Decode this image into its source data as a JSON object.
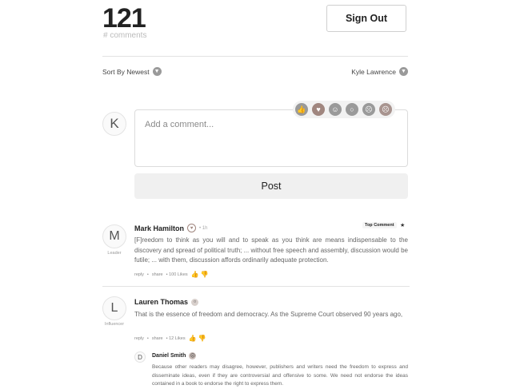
{
  "header": {
    "count": "121",
    "count_label": "# comments",
    "signout_label": "Sign Out"
  },
  "sortbar": {
    "sort_label": "Sort By Newest",
    "user_name": "Kyle Lawrence"
  },
  "composer": {
    "avatar_letter": "K",
    "placeholder": "Add a comment...",
    "post_label": "Post",
    "reactions": [
      "like-icon",
      "heart-icon",
      "laugh-icon",
      "wow-icon",
      "sad-icon",
      "angry-icon"
    ]
  },
  "comments": [
    {
      "avatar_letter": "M",
      "role": "Leader",
      "name": "Mark Hamilton",
      "name_icon": "heart-icon",
      "time": "• 1h",
      "badge": "Top Comment",
      "body": "[F]reedom to think as you will and to speak as you think are means indispensable to the discovery and spread of political truth; ... without free speech and assembly, discussion would be futile; ... with them, discussion affords ordinarily adequate protection.",
      "reply": "reply",
      "share": "share",
      "likes": "• 100 Likes"
    },
    {
      "avatar_letter": "L",
      "role": "Influencer",
      "name": "Lauren Thomas",
      "name_icon": "wow-icon",
      "body": "That is the essence of freedom and democracy. As the Supreme Court observed 90 years ago,",
      "reply": "reply",
      "share": "share",
      "likes": "• 12 Likes"
    }
  ],
  "reply": {
    "avatar_letter": "D",
    "name": "Daniel Smith",
    "name_icon": "angry-icon",
    "body": "Because other readers may disagree, however, publishers and writers need the freedom to express and disseminate ideas, even if they are controversial and offensive to some. We need not endorse the ideas contained in a book to endorse the right to express them."
  }
}
